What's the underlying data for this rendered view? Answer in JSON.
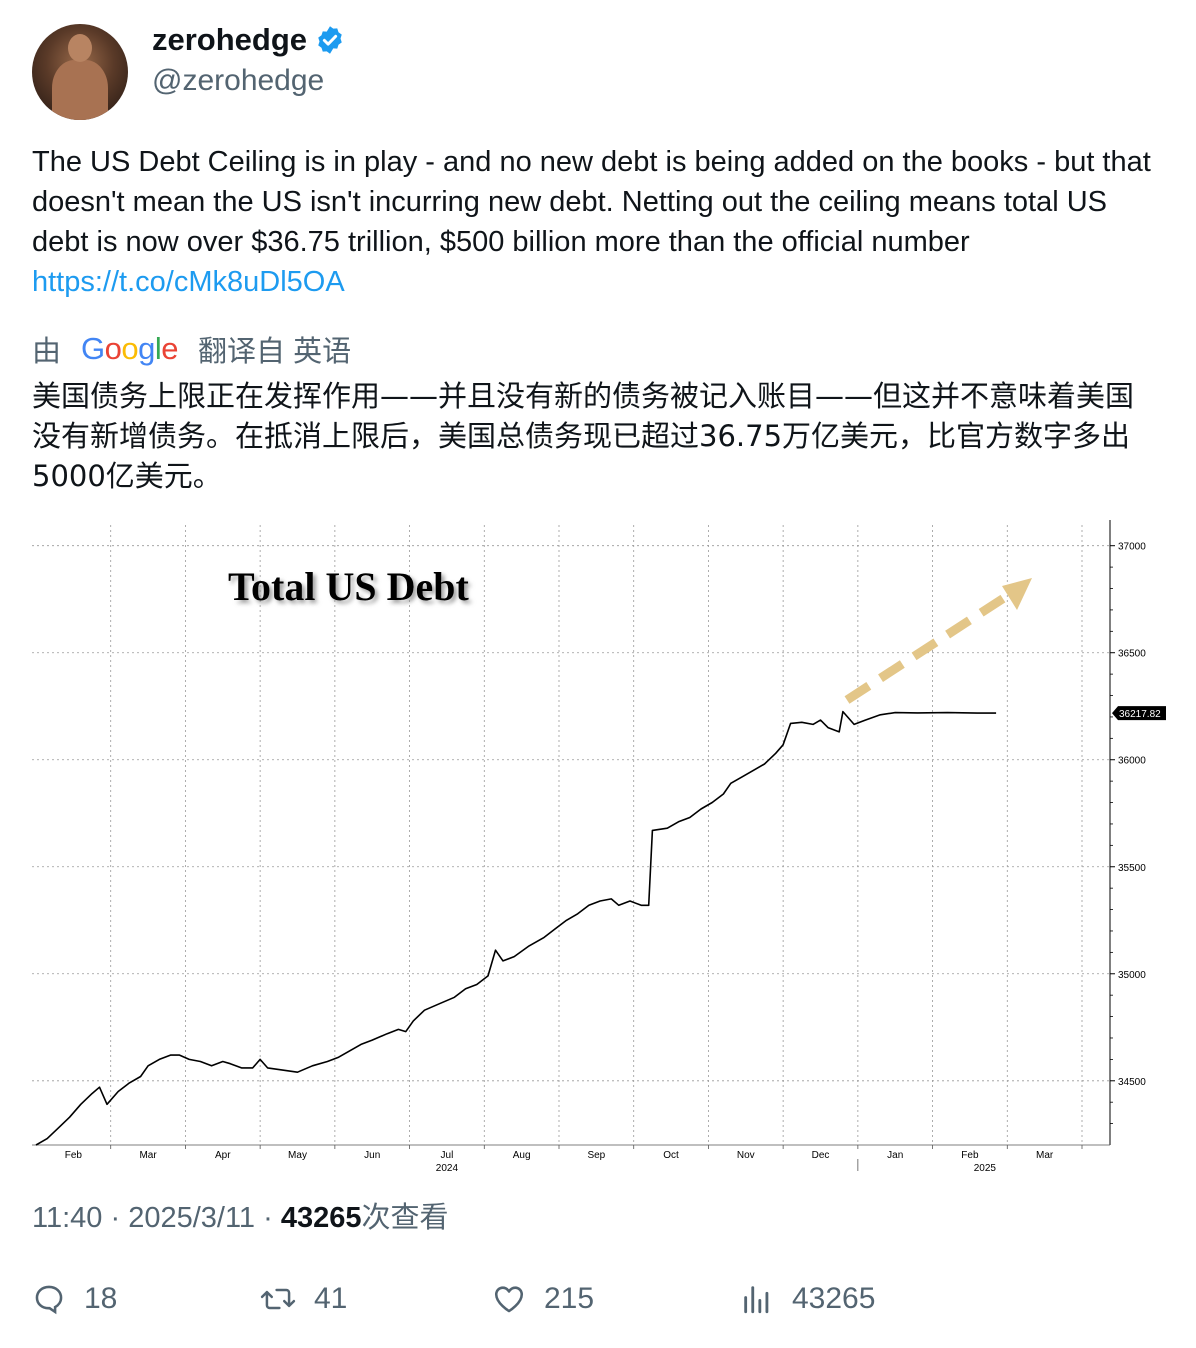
{
  "author": {
    "display_name": "zerohedge",
    "handle": "@zerohedge",
    "verified": true,
    "verified_color": "#1d9bf0"
  },
  "tweet": {
    "text": "The US Debt Ceiling is in play - and no new debt is being added on the books - but that doesn't mean the US isn't incurring new debt. Netting out the ceiling means total US debt is now over $36.75 trillion, $500 billion more than the official number ",
    "link": "https://t.co/cMk8uDl5OA",
    "link_color": "#1d9bf0"
  },
  "translation": {
    "prefix": "由",
    "brand": "Google",
    "suffix": "翻译自 英语",
    "text": "美国债务上限正在发挥作用——并且没有新的债务被记入账目——但这并不意味着美国没有新增债务。在抵消上限后，美国总债务现已超过36.75万亿美元，比官方数字多出5000亿美元。"
  },
  "meta": {
    "time": "11:40",
    "date": "2025/3/11",
    "views_count": "43265",
    "views_label": "次查看"
  },
  "actions": {
    "replies": "18",
    "reposts": "41",
    "likes": "215",
    "views": "43265"
  },
  "chart_data": {
    "type": "line",
    "title": "Total US Debt",
    "ylim": [
      34200,
      37050
    ],
    "y_ticks": [
      34500,
      35000,
      35500,
      36000,
      36500,
      37000
    ],
    "x_ticks": [
      "Feb",
      "Mar",
      "Apr",
      "May",
      "Jun",
      "Jul",
      "Aug",
      "Sep",
      "Oct",
      "Nov",
      "Dec",
      "Jan",
      "Feb",
      "Mar"
    ],
    "year_labels": [
      "2024",
      "2025"
    ],
    "last_value_label": "36217.82",
    "grid": true,
    "arrow_color": "#e3c688",
    "x_range": [
      0,
      14
    ],
    "series": [
      {
        "values": [
          [
            0.0,
            34200
          ],
          [
            0.15,
            34230
          ],
          [
            0.3,
            34280
          ],
          [
            0.45,
            34330
          ],
          [
            0.6,
            34390
          ],
          [
            0.75,
            34440
          ],
          [
            0.85,
            34470
          ],
          [
            0.95,
            34390
          ],
          [
            1.1,
            34450
          ],
          [
            1.25,
            34490
          ],
          [
            1.4,
            34520
          ],
          [
            1.5,
            34570
          ],
          [
            1.65,
            34600
          ],
          [
            1.8,
            34620
          ],
          [
            1.92,
            34620
          ],
          [
            2.05,
            34600
          ],
          [
            2.2,
            34590
          ],
          [
            2.35,
            34570
          ],
          [
            2.5,
            34590
          ],
          [
            2.6,
            34580
          ],
          [
            2.75,
            34560
          ],
          [
            2.9,
            34560
          ],
          [
            3.0,
            34600
          ],
          [
            3.1,
            34560
          ],
          [
            3.3,
            34550
          ],
          [
            3.5,
            34540
          ],
          [
            3.7,
            34570
          ],
          [
            3.9,
            34590
          ],
          [
            4.05,
            34610
          ],
          [
            4.2,
            34640
          ],
          [
            4.35,
            34670
          ],
          [
            4.5,
            34690
          ],
          [
            4.7,
            34720
          ],
          [
            4.85,
            34740
          ],
          [
            4.95,
            34730
          ],
          [
            5.05,
            34780
          ],
          [
            5.2,
            34830
          ],
          [
            5.4,
            34860
          ],
          [
            5.6,
            34890
          ],
          [
            5.75,
            34930
          ],
          [
            5.9,
            34950
          ],
          [
            6.05,
            34990
          ],
          [
            6.15,
            35110
          ],
          [
            6.25,
            35060
          ],
          [
            6.4,
            35080
          ],
          [
            6.6,
            35130
          ],
          [
            6.8,
            35170
          ],
          [
            6.95,
            35210
          ],
          [
            7.1,
            35250
          ],
          [
            7.25,
            35280
          ],
          [
            7.4,
            35320
          ],
          [
            7.55,
            35340
          ],
          [
            7.7,
            35350
          ],
          [
            7.8,
            35320
          ],
          [
            7.95,
            35340
          ],
          [
            8.1,
            35320
          ],
          [
            8.2,
            35320
          ],
          [
            8.25,
            35670
          ],
          [
            8.45,
            35680
          ],
          [
            8.6,
            35710
          ],
          [
            8.75,
            35730
          ],
          [
            8.9,
            35770
          ],
          [
            9.05,
            35800
          ],
          [
            9.2,
            35840
          ],
          [
            9.3,
            35890
          ],
          [
            9.45,
            35920
          ],
          [
            9.6,
            35950
          ],
          [
            9.75,
            35980
          ],
          [
            9.9,
            36030
          ],
          [
            10.0,
            36070
          ],
          [
            10.1,
            36170
          ],
          [
            10.25,
            36175
          ],
          [
            10.4,
            36165
          ],
          [
            10.5,
            36185
          ],
          [
            10.6,
            36150
          ],
          [
            10.75,
            36130
          ],
          [
            10.8,
            36225
          ],
          [
            10.95,
            36165
          ],
          [
            11.1,
            36185
          ],
          [
            11.3,
            36210
          ],
          [
            11.5,
            36220
          ],
          [
            11.8,
            36219
          ],
          [
            12.2,
            36220
          ],
          [
            12.6,
            36218
          ],
          [
            12.85,
            36218
          ]
        ]
      }
    ]
  }
}
